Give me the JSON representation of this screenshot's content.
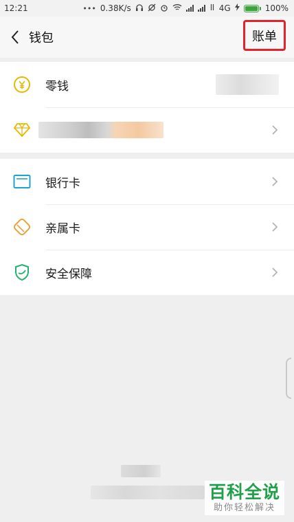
{
  "status_bar": {
    "time": "12:21",
    "dots": "•••",
    "speed": "0.38K/s",
    "network": "4G",
    "battery": "100%"
  },
  "nav": {
    "title": "钱包",
    "bill_label": "账单",
    "bill_highlight_color": "#e3222b"
  },
  "wallet": {
    "items": [
      {
        "label": "零钱",
        "icon": "yuan-coin-icon"
      },
      {
        "label": "",
        "icon": "diamond-icon"
      }
    ]
  },
  "services": {
    "items": [
      {
        "label": "银行卡",
        "icon": "bank-card-icon"
      },
      {
        "label": "亲属卡",
        "icon": "family-card-icon"
      },
      {
        "label": "安全保障",
        "icon": "security-shield-icon"
      }
    ]
  },
  "watermark": {
    "title": "百科全说",
    "subtitle": "助你轻松解决"
  },
  "colors": {
    "accent_yellow": "#e6b800",
    "accent_blue": "#1aa6c8",
    "accent_orange": "#e8a23c",
    "accent_green": "#1fb36b",
    "watermark_green": "#21a04a"
  }
}
